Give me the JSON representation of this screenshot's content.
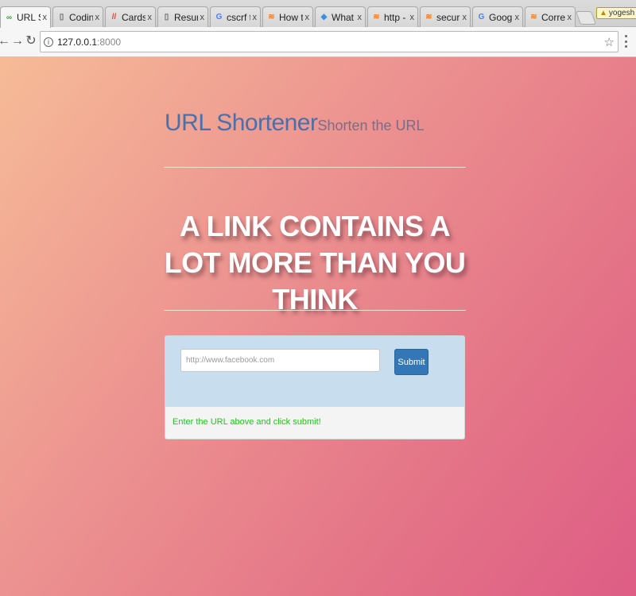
{
  "browser": {
    "tabs": [
      {
        "label": "URL Sh",
        "icon": "link-favicon-icon",
        "glyph": "∞",
        "color": "#3a9a3a",
        "active": true
      },
      {
        "label": "Coding",
        "icon": "document-favicon-icon",
        "glyph": "▯",
        "color": "#666666",
        "active": false
      },
      {
        "label": "Cards",
        "icon": "cards-favicon-icon",
        "glyph": "//",
        "color": "#d9483b",
        "active": false
      },
      {
        "label": "Resum",
        "icon": "document-favicon-icon",
        "glyph": "▯",
        "color": "#666666",
        "active": false
      },
      {
        "label": "cscrf t",
        "icon": "google-favicon-icon",
        "glyph": "G",
        "color": "#4285f4",
        "active": false
      },
      {
        "label": "How t",
        "icon": "stackoverflow-favicon-icon",
        "glyph": "≋",
        "color": "#f48024",
        "active": false
      },
      {
        "label": "What i",
        "icon": "quora-favicon-icon",
        "glyph": "◆",
        "color": "#3b8fe0",
        "active": false
      },
      {
        "label": "http -",
        "icon": "stackoverflow-favicon-icon",
        "glyph": "≋",
        "color": "#f48024",
        "active": false
      },
      {
        "label": "securi",
        "icon": "stackoverflow-favicon-icon",
        "glyph": "≋",
        "color": "#f48024",
        "active": false
      },
      {
        "label": "Googl",
        "icon": "google-favicon-icon",
        "glyph": "G",
        "color": "#4285f4",
        "active": false
      },
      {
        "label": "Correc",
        "icon": "stackoverflow-favicon-icon",
        "glyph": "≋",
        "color": "#f48024",
        "active": false
      }
    ],
    "close_glyph": "x",
    "profile_name": "yogesh",
    "address": {
      "host": "127.0.0.1",
      "port": ":8000"
    }
  },
  "header": {
    "brand_title": "URL Shortener",
    "brand_tagline": "Shorten the URL"
  },
  "hero": {
    "headline": "A LINK CONTAINS A LOT MORE THAN YOU THINK"
  },
  "form": {
    "url_placeholder": "http://www.facebook.com",
    "url_value": "",
    "submit_label": "Submit",
    "status_message": "Enter the URL above and click submit!",
    "status_color": "#23c023",
    "button_color": "#3477b6"
  }
}
